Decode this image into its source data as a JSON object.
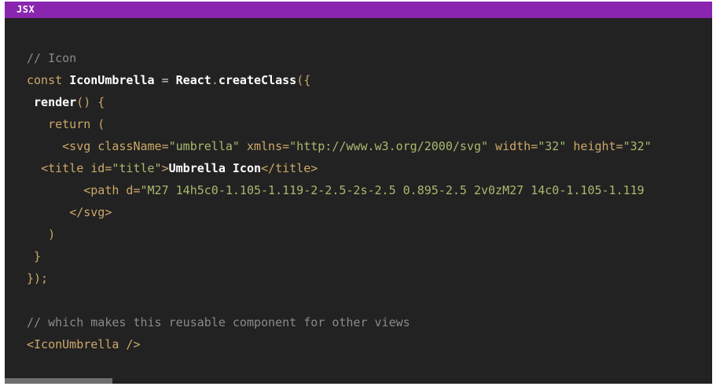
{
  "header": {
    "language": "JSX"
  },
  "code_lines": [
    [
      {
        "t": "comment",
        "v": "// Icon"
      }
    ],
    [
      {
        "t": "keyword",
        "v": "const "
      },
      {
        "t": "name",
        "v": "IconUmbrella"
      },
      {
        "t": "plain",
        "v": " = "
      },
      {
        "t": "name",
        "v": "React"
      },
      {
        "t": "punct",
        "v": "."
      },
      {
        "t": "name",
        "v": "createClass"
      },
      {
        "t": "punct",
        "v": "({"
      }
    ],
    [
      {
        "t": "plain",
        "v": " "
      },
      {
        "t": "name",
        "v": "render"
      },
      {
        "t": "punct",
        "v": "() {"
      }
    ],
    [
      {
        "t": "plain",
        "v": "   "
      },
      {
        "t": "keyword",
        "v": "return"
      },
      {
        "t": "punct",
        "v": " ("
      }
    ],
    [
      {
        "t": "plain",
        "v": "     "
      },
      {
        "t": "tag",
        "v": "<svg className="
      },
      {
        "t": "string",
        "v": "\"umbrella\""
      },
      {
        "t": "tag",
        "v": " xmlns="
      },
      {
        "t": "string",
        "v": "\"http://www.w3.org/2000/svg\""
      },
      {
        "t": "tag",
        "v": " width="
      },
      {
        "t": "string",
        "v": "\"32\""
      },
      {
        "t": "tag",
        "v": " height="
      },
      {
        "t": "string",
        "v": "\"32\""
      }
    ],
    [
      {
        "t": "plain",
        "v": "  "
      },
      {
        "t": "tag",
        "v": "<title id="
      },
      {
        "t": "string",
        "v": "\"title\""
      },
      {
        "t": "tag",
        "v": ">"
      },
      {
        "t": "text",
        "v": "Umbrella Icon"
      },
      {
        "t": "tag",
        "v": "</title>"
      }
    ],
    [
      {
        "t": "plain",
        "v": "        "
      },
      {
        "t": "tag",
        "v": "<path d="
      },
      {
        "t": "string",
        "v": "\"M27 14h5c0-1.105-1.119-2-2.5-2s-2.5 0.895-2.5 2v0zM27 14c0-1.105-1.119"
      }
    ],
    [
      {
        "t": "plain",
        "v": "      "
      },
      {
        "t": "tag",
        "v": "</svg>"
      }
    ],
    [
      {
        "t": "plain",
        "v": "   "
      },
      {
        "t": "punct",
        "v": ")"
      }
    ],
    [
      {
        "t": "plain",
        "v": " "
      },
      {
        "t": "punct",
        "v": "}"
      }
    ],
    [
      {
        "t": "punct",
        "v": "});"
      }
    ],
    [],
    [
      {
        "t": "comment",
        "v": "// which makes this reusable component for other views"
      }
    ],
    [
      {
        "t": "tag",
        "v": "<IconUmbrella />"
      }
    ]
  ]
}
